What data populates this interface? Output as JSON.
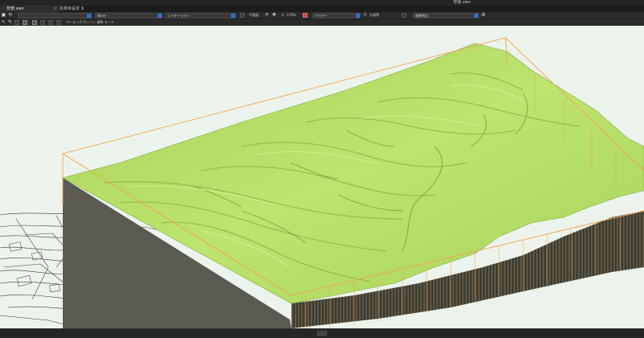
{
  "window": {
    "title": "背景.vwx"
  },
  "tabs": [
    {
      "label": "背景.vwx",
      "close": "×"
    },
    {
      "label": "名称未設定 1",
      "close": "×"
    }
  ],
  "toolbar": {
    "class_dropdown": "None",
    "layer_dropdown": "レイヤーライト",
    "view_label": "平面図",
    "zoom_label": "170%",
    "render_dropdown": "ワイヤー",
    "lighting_label": "光源等",
    "saved_view_dropdown": "標準視点"
  },
  "mode_bar": {
    "hint_text": "ワーキングプレーン: 標準 モード"
  },
  "icons": {
    "arrow": "arrow-icon",
    "pencil": "pencil-icon",
    "grid": "grid-icon",
    "flyover": "flyover-icon",
    "walkthrough": "walkthrough-icon",
    "camera": "camera-icon"
  },
  "colors": {
    "terrain": "#b8e26a",
    "bounding_box": "#f0a14c",
    "viewport_bg": "#ecf3ec",
    "ui_bg": "#2b2b2b"
  }
}
